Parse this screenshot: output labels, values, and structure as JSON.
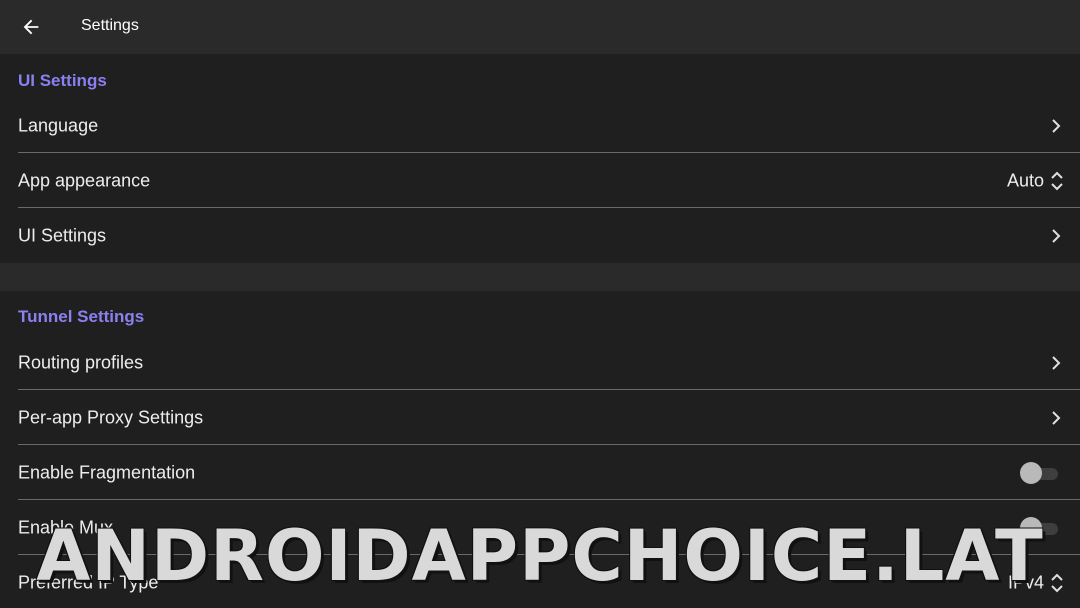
{
  "appbar": {
    "title": "Settings",
    "back_icon": "arrow-left-icon"
  },
  "sections": [
    {
      "header": "UI Settings",
      "rows": [
        {
          "label": "Language",
          "control": "chevron"
        },
        {
          "label": "App appearance",
          "control": "select",
          "value": "Auto"
        },
        {
          "label": "UI Settings",
          "control": "chevron"
        }
      ]
    },
    {
      "header": "Tunnel Settings",
      "rows": [
        {
          "label": "Routing profiles",
          "control": "chevron"
        },
        {
          "label": "Per-app Proxy Settings",
          "control": "chevron"
        },
        {
          "label": "Enable Fragmentation",
          "control": "toggle",
          "checked": false
        },
        {
          "label": "Enable Mux",
          "control": "toggle",
          "checked": false
        },
        {
          "label": "Preferred IP Type",
          "control": "select",
          "value": "IPv4"
        }
      ]
    }
  ],
  "watermark": "ANDROIDAPPCHOICE.LAT",
  "colors": {
    "accent": "#8b80f0",
    "background": "#1f1f1f",
    "appbar": "#2a2a2a"
  }
}
